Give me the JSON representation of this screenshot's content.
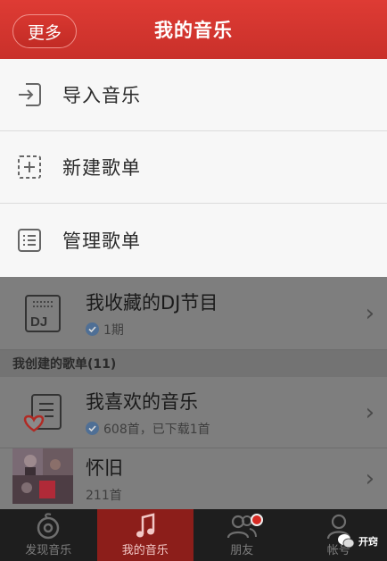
{
  "header": {
    "more_label": "更多",
    "title": "我的音乐"
  },
  "menu": {
    "items": [
      {
        "label": "导入音乐",
        "icon": "import-icon"
      },
      {
        "label": "新建歌单",
        "icon": "new-playlist-icon"
      },
      {
        "label": "管理歌单",
        "icon": "manage-list-icon"
      }
    ]
  },
  "list": {
    "dj": {
      "title": "我收藏的DJ节目",
      "sub": "1期",
      "icon_text": "DJ"
    },
    "section_label": "我创建的歌单(11)",
    "favorites": {
      "title": "我喜欢的音乐",
      "sub": "608首，已下载1首"
    },
    "nostalgia": {
      "title": "怀旧",
      "sub": "211首"
    }
  },
  "tabs": [
    {
      "label": "发现音乐",
      "icon": "discover-icon"
    },
    {
      "label": "我的音乐",
      "icon": "music-note-icon"
    },
    {
      "label": "朋友",
      "icon": "friends-icon"
    },
    {
      "label": "帐号",
      "icon": "account-icon"
    }
  ],
  "watermark": {
    "label": "开窍"
  },
  "colors": {
    "accent": "#d2342d",
    "active_tab": "#8c1e1a",
    "menu_bg": "#f7f7f7"
  }
}
